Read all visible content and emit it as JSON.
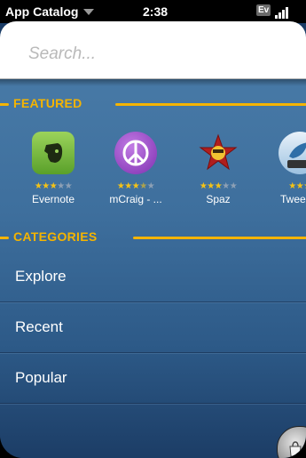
{
  "status_bar": {
    "app_title": "App Catalog",
    "time": "2:38",
    "carrier_badge": "Ev"
  },
  "search": {
    "placeholder": "Search..."
  },
  "featured": {
    "header": "FEATURED",
    "apps": [
      {
        "name": "Evernote",
        "rating": 3,
        "icon": "elephant-icon",
        "color": "#7ac143"
      },
      {
        "name": "mCraig - ...",
        "rating": 3.5,
        "icon": "peace-sign-icon",
        "color": "#9b46c7"
      },
      {
        "name": "Spaz",
        "rating": 3,
        "icon": "spaz-star-icon",
        "color": "#b01e1e"
      },
      {
        "name": "Twee",
        "rating": 3,
        "icon": "bird-icon",
        "color": "#6aa8d8"
      }
    ]
  },
  "categories": {
    "header": "CATEGORIES",
    "items": [
      "Explore",
      "Recent",
      "Popular"
    ]
  },
  "colors": {
    "accent": "#f5b400",
    "background": "#3e6f9d"
  }
}
